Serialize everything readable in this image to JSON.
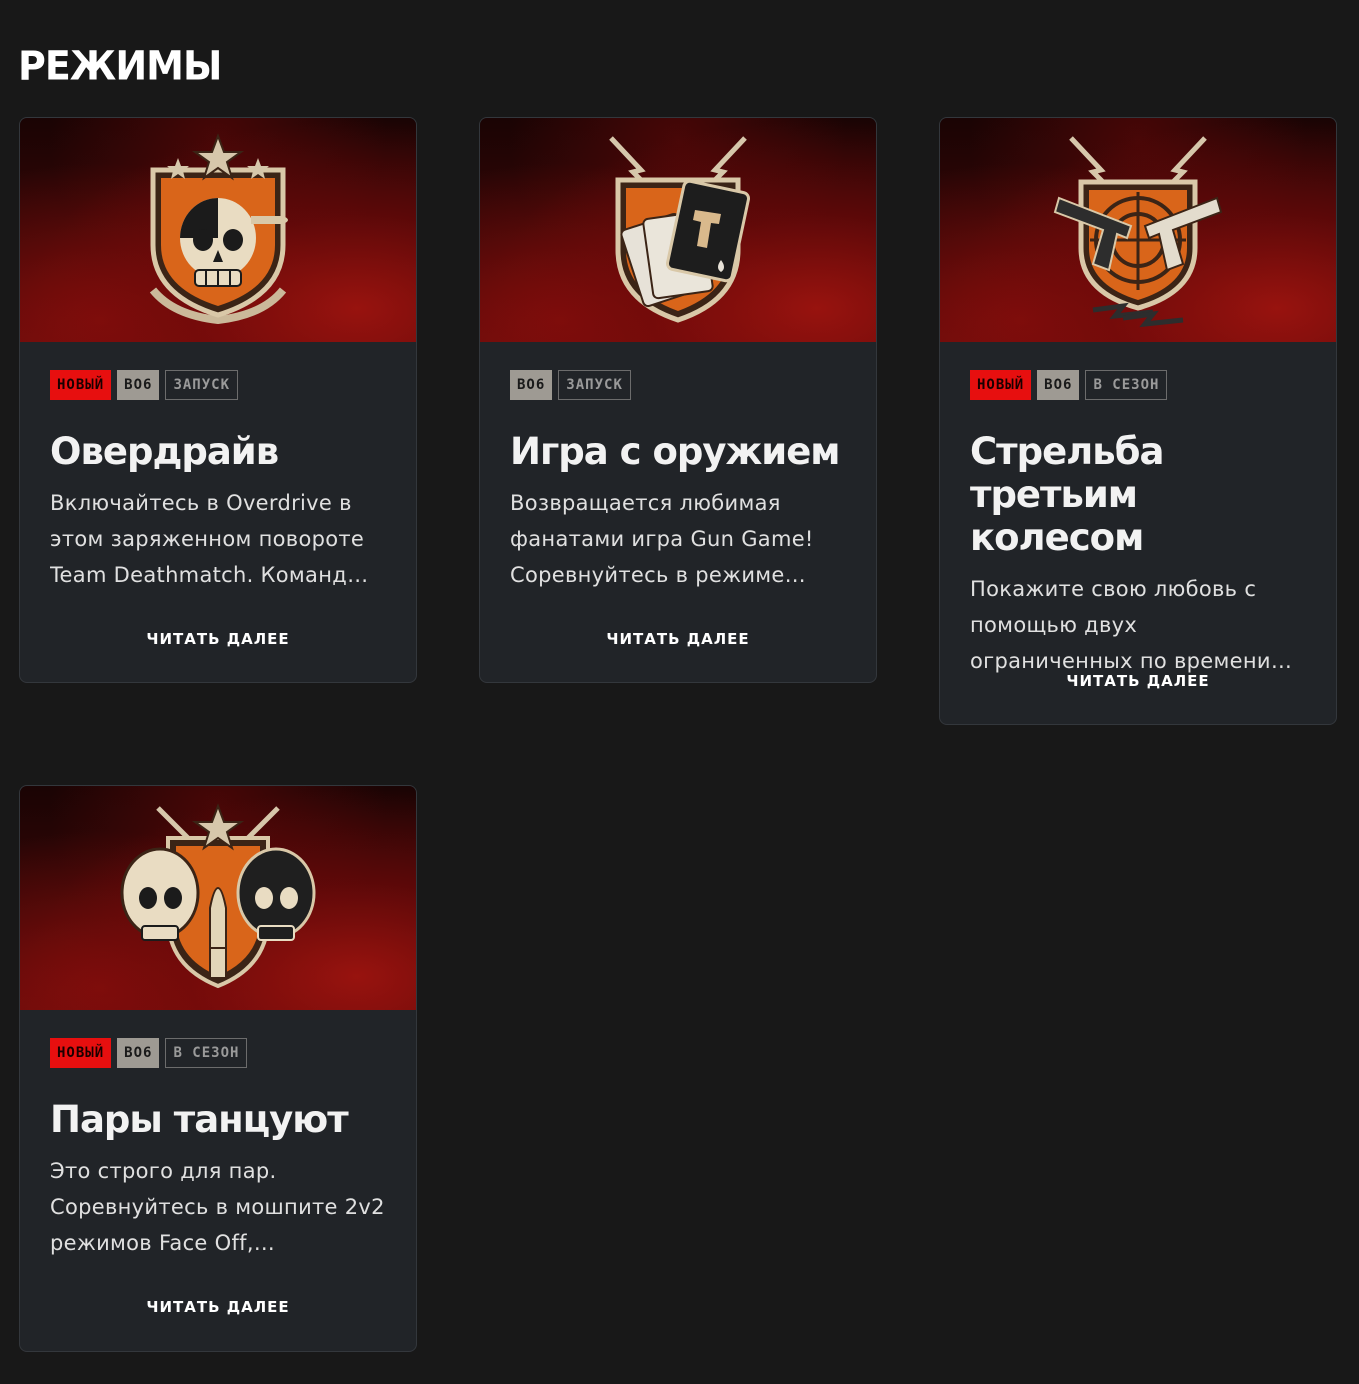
{
  "section": {
    "title": "РЕЖИМЫ"
  },
  "colors": {
    "background": "#181818",
    "card": "#212428",
    "tag_new": "#e70f0f",
    "tag_game": "#9e9a93"
  },
  "cards": [
    {
      "emblem_icon": "skull-emblem-icon",
      "tags": [
        "НОВЫЙ",
        "BO6",
        "ЗАПУСК"
      ],
      "title": "Овердрайв",
      "description": "Включайтесь в Overdrive в этом заряженном повороте Team Deathmatch. Команд…",
      "read_more": "ЧИТАТЬ ДАЛЕЕ"
    },
    {
      "emblem_icon": "playing-cards-emblem-icon",
      "tags": [
        "BO6",
        "ЗАПУСК"
      ],
      "title": "Игра с оружием",
      "description": "Возвращается любимая фанатами игра Gun Game! Соревнуйтесь в режиме…",
      "read_more": "ЧИТАТЬ ДАЛЕЕ"
    },
    {
      "emblem_icon": "crossed-pistols-emblem-icon",
      "tags": [
        "НОВЫЙ",
        "BO6",
        "В СЕЗОН"
      ],
      "title": "Стрельба третьим колесом",
      "description": "Покажите свою любовь с помощью двух ограниченных по времени…",
      "read_more": "ЧИТАТЬ ДАЛЕЕ"
    },
    {
      "emblem_icon": "twin-skulls-bullet-emblem-icon",
      "tags": [
        "НОВЫЙ",
        "BO6",
        "В СЕЗОН"
      ],
      "title": "Пары танцуют",
      "description": "Это строго для пар. Соревнуйтесь в мошпите 2v2 режимов Face Off,…",
      "read_more": "ЧИТАТЬ ДАЛЕЕ"
    }
  ]
}
